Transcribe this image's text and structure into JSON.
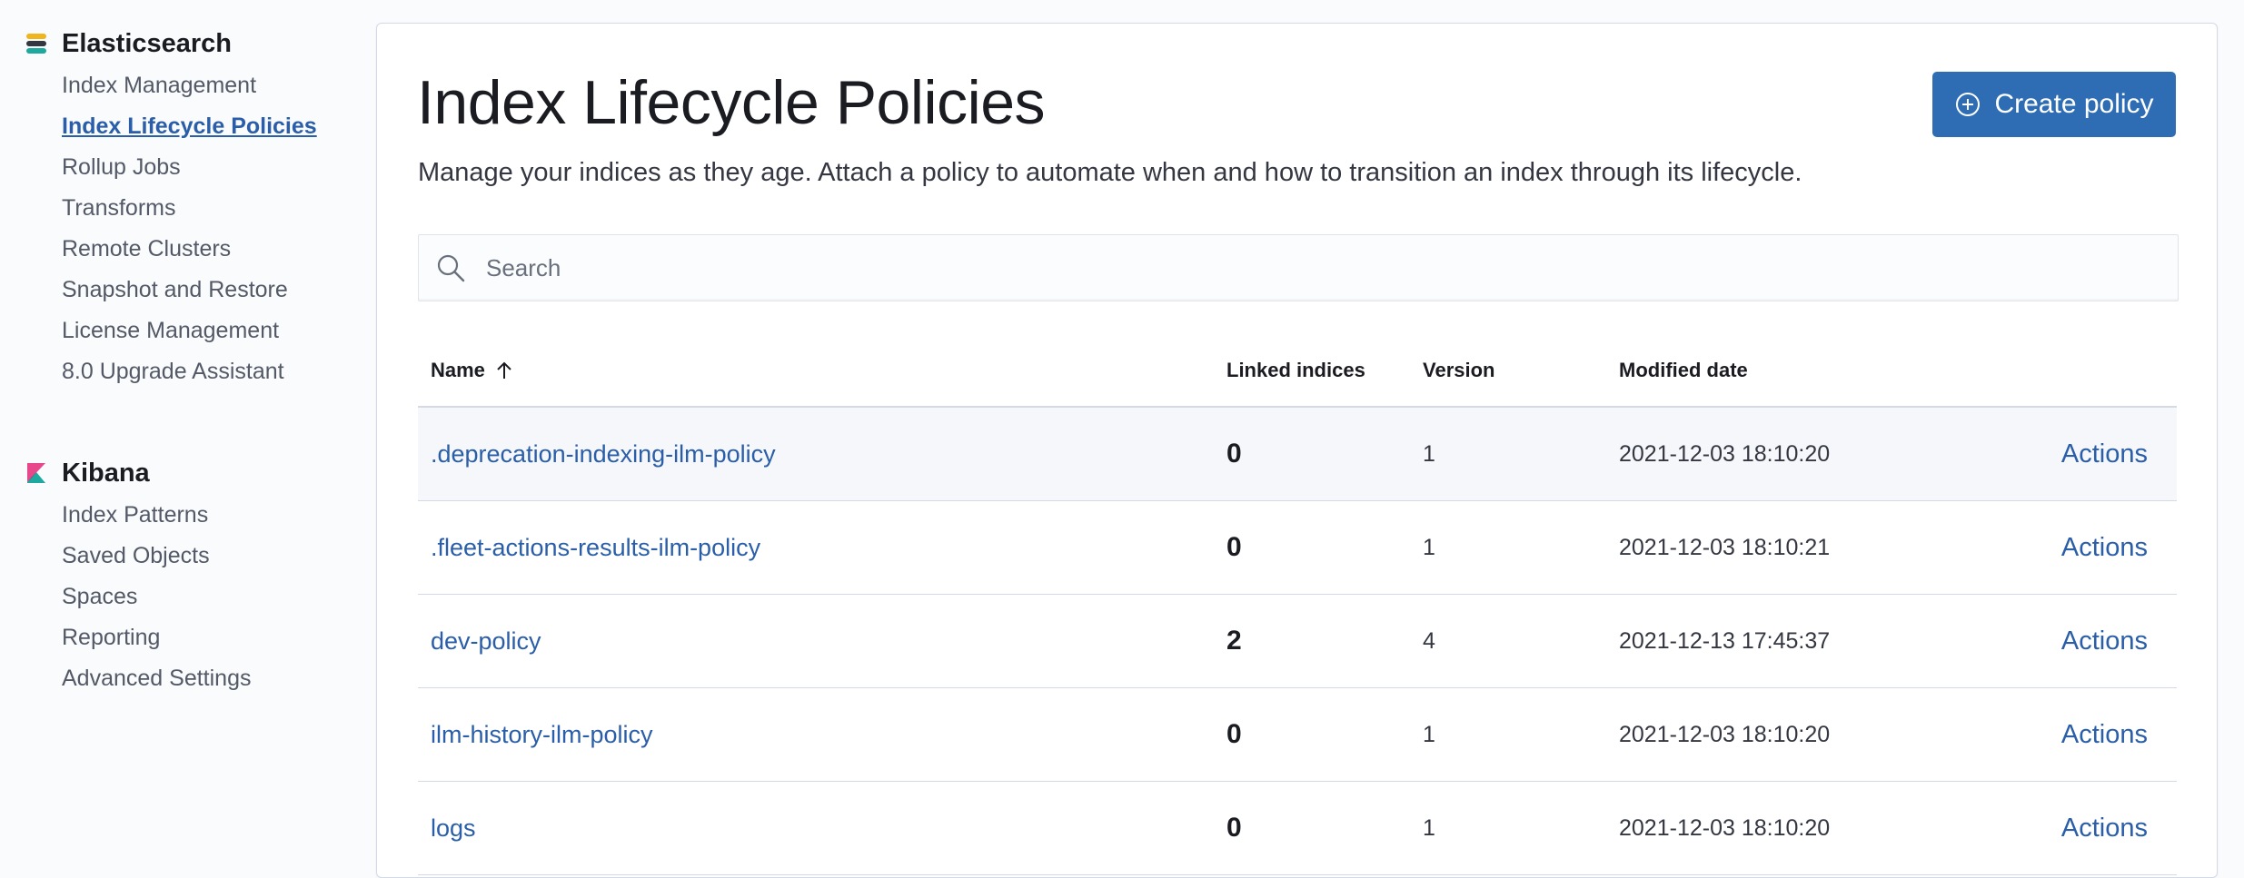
{
  "sidebar": {
    "elasticsearch": {
      "title": "Elasticsearch",
      "items": [
        {
          "label": "Index Management"
        },
        {
          "label": "Index Lifecycle Policies",
          "active": true
        },
        {
          "label": "Rollup Jobs"
        },
        {
          "label": "Transforms"
        },
        {
          "label": "Remote Clusters"
        },
        {
          "label": "Snapshot and Restore"
        },
        {
          "label": "License Management"
        },
        {
          "label": "8.0 Upgrade Assistant"
        }
      ]
    },
    "kibana": {
      "title": "Kibana",
      "items": [
        {
          "label": "Index Patterns"
        },
        {
          "label": "Saved Objects"
        },
        {
          "label": "Spaces"
        },
        {
          "label": "Reporting"
        },
        {
          "label": "Advanced Settings"
        }
      ]
    }
  },
  "page": {
    "title": "Index Lifecycle Policies",
    "description": "Manage your indices as they age. Attach a policy to automate when and how to transition an index through its lifecycle.",
    "create_button": "Create policy",
    "create_icon": "plus-in-circle-icon",
    "search_placeholder": "Search",
    "search_icon": "search-icon"
  },
  "table": {
    "columns": {
      "name": "Name",
      "linked": "Linked indices",
      "version": "Version",
      "modified": "Modified date"
    },
    "sort_icon": "arrow-up-icon",
    "rows": [
      {
        "name": ".deprecation-indexing-ilm-policy",
        "linked": "0",
        "version": "1",
        "modified": "2021-12-03 18:10:20",
        "actions": "Actions"
      },
      {
        "name": ".fleet-actions-results-ilm-policy",
        "linked": "0",
        "version": "1",
        "modified": "2021-12-03 18:10:21",
        "actions": "Actions"
      },
      {
        "name": "dev-policy",
        "linked": "2",
        "version": "4",
        "modified": "2021-12-13 17:45:37",
        "actions": "Actions"
      },
      {
        "name": "ilm-history-ilm-policy",
        "linked": "0",
        "version": "1",
        "modified": "2021-12-03 18:10:20",
        "actions": "Actions"
      },
      {
        "name": "logs",
        "linked": "0",
        "version": "1",
        "modified": "2021-12-03 18:10:20",
        "actions": "Actions"
      }
    ]
  },
  "colors": {
    "primary": "#2e6db4",
    "link": "#2a5ea8",
    "border": "#d3dae6"
  }
}
